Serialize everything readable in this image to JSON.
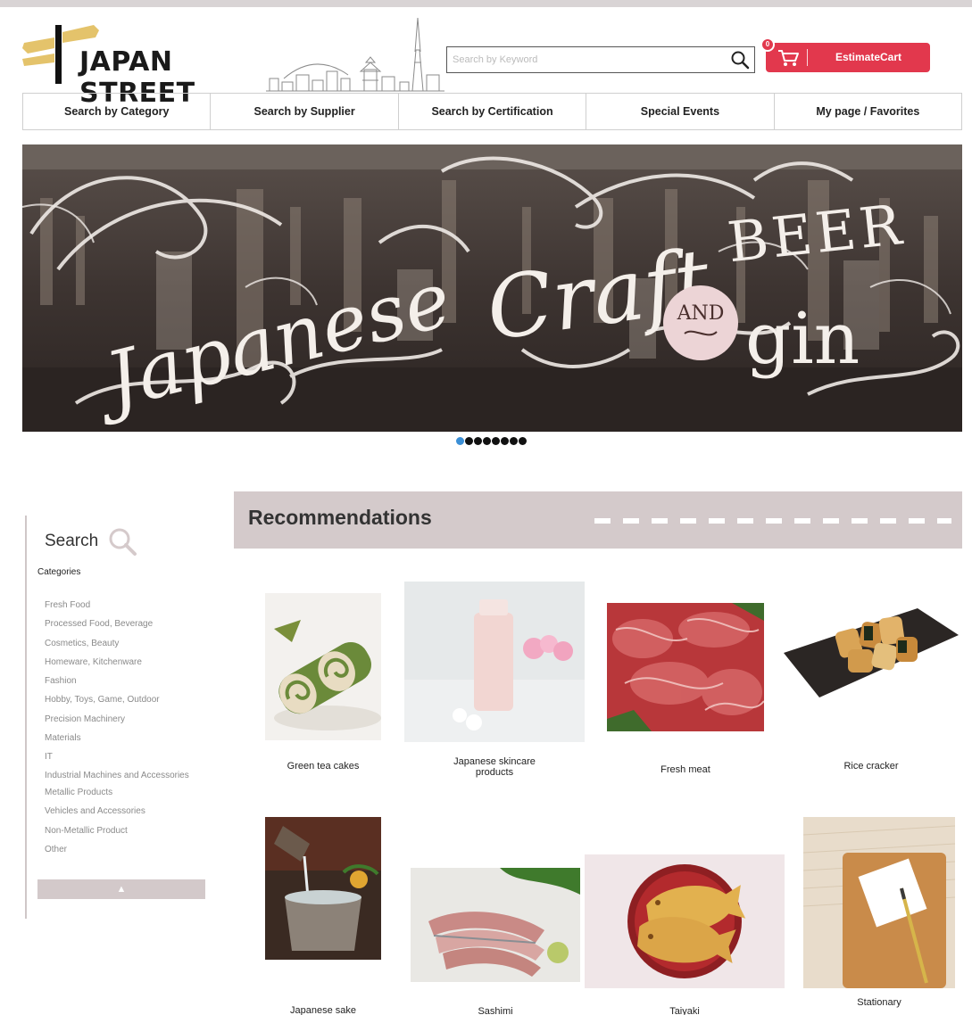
{
  "header": {
    "logo_text": "JAPAN STREET",
    "search_placeholder": "Search by Keyword",
    "cart_label": "EstimateCart",
    "cart_count": "0"
  },
  "nav": [
    {
      "label": "Search by Category"
    },
    {
      "label": "Search by  Supplier"
    },
    {
      "label": "Search by Certification"
    },
    {
      "label": "Special Events"
    },
    {
      "label": "My page / Favorites"
    }
  ],
  "banner": {
    "word_1": "Japanese",
    "word_2": "Craft",
    "word_3": "BEER",
    "word_4": "AND",
    "word_5": "gin",
    "slide_count": 8,
    "active_slide": 1
  },
  "sidebar": {
    "title": "Search",
    "categories_heading": "Categories",
    "categories": [
      "Fresh Food",
      "Processed Food, Beverage",
      "Cosmetics, Beauty",
      "Homeware, Kitchenware",
      "Fashion",
      "Hobby, Toys, Game, Outdoor",
      "Precision Machinery",
      "Materials",
      "IT",
      "Industrial Machines and Accessories",
      "Metallic Products",
      "Vehicles and Accessories",
      "Non-Metallic Product",
      "Other"
    ],
    "toggle_symbol": "▲"
  },
  "recommendations": {
    "title": "Recommendations",
    "products": [
      {
        "label": "Green tea cakes"
      },
      {
        "label": "Japanese skincare products"
      },
      {
        "label": "Fresh meat"
      },
      {
        "label": "Rice cracker"
      },
      {
        "label": "Japanese sake"
      },
      {
        "label": "Sashimi"
      },
      {
        "label": "Taiyaki"
      },
      {
        "label": "Stationary"
      }
    ]
  },
  "colors": {
    "accent_red": "#e2384d",
    "section_bar": "#d4cacb",
    "active_dot": "#3b8fd6"
  }
}
